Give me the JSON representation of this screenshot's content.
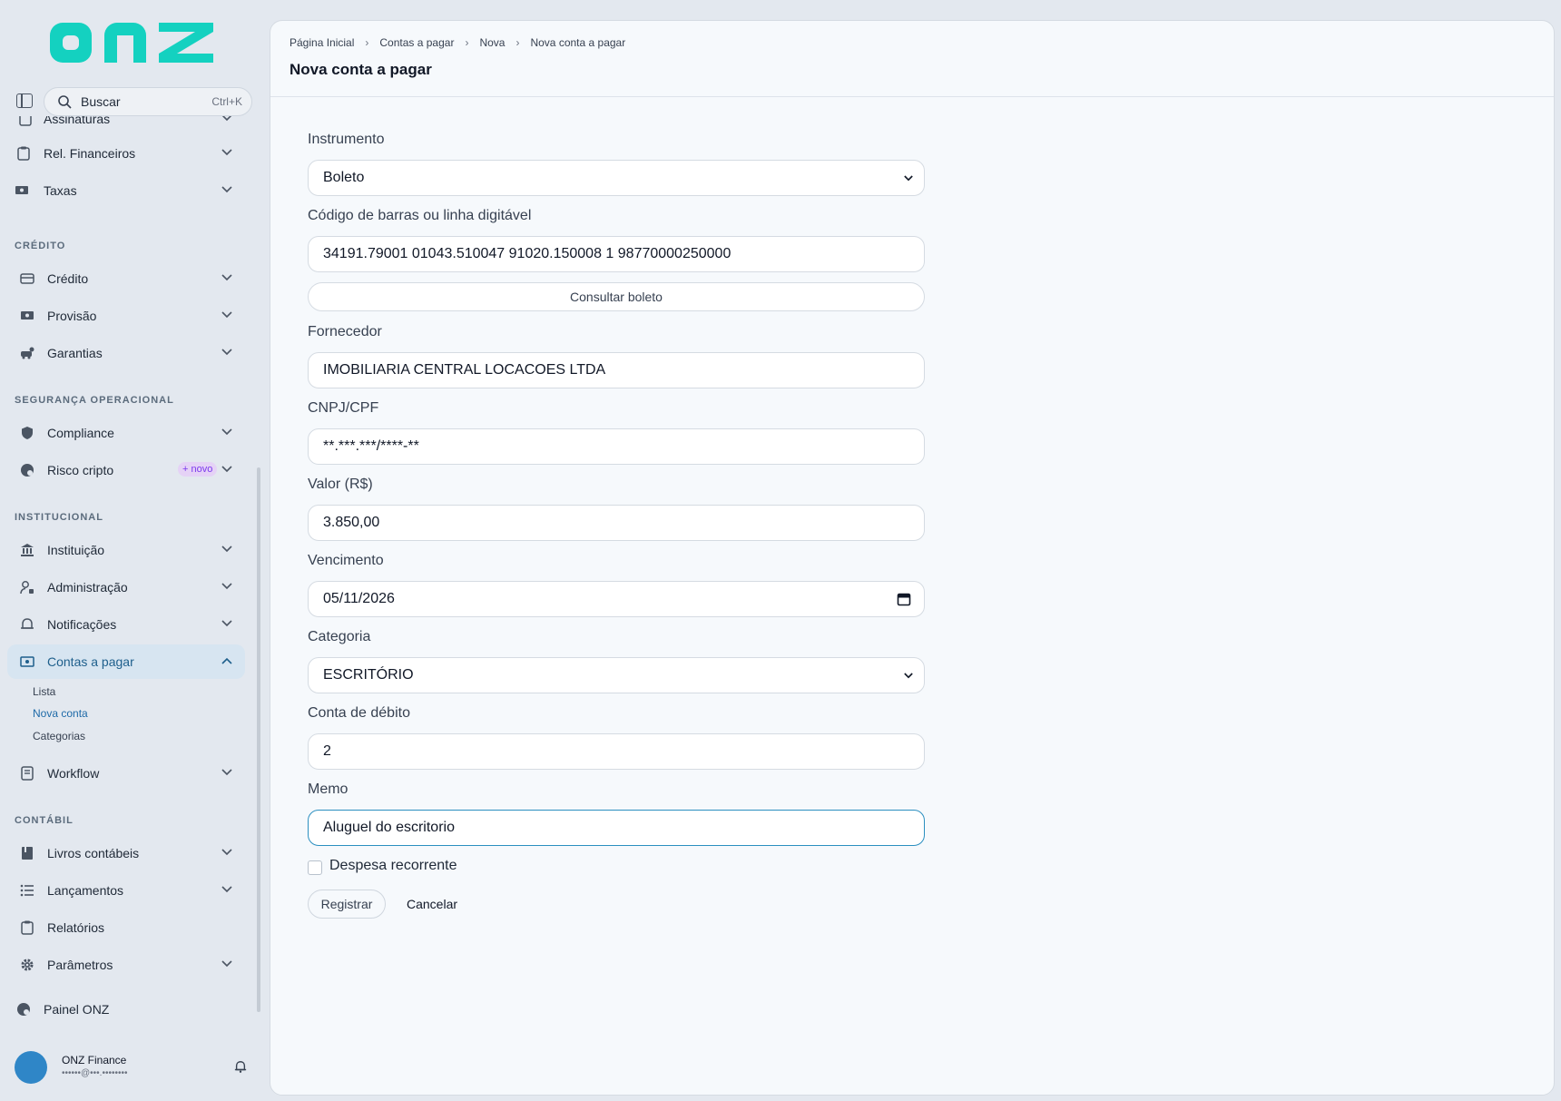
{
  "brand": {
    "logo_text": "onz",
    "logo_color": "#14d1c0"
  },
  "sidebar": {
    "search_placeholder": "Buscar",
    "search_shortcut": "Ctrl+K",
    "items": [
      {
        "label": "Assinaturas",
        "icon": "receipt-icon"
      },
      {
        "label": "Rel. Financeiros",
        "icon": "clipboard-icon"
      },
      {
        "label": "Taxas",
        "icon": "cash-icon"
      },
      {
        "label": "Crédito",
        "icon": "card-icon"
      },
      {
        "label": "Provisão",
        "icon": "cash-icon"
      },
      {
        "label": "Garantias",
        "icon": "car-icon"
      },
      {
        "label": "Compliance",
        "icon": "shield-icon"
      },
      {
        "label": "Risco cripto",
        "icon": "globe-icon",
        "badge": "+ novo"
      },
      {
        "label": "Instituição",
        "icon": "bank-icon"
      },
      {
        "label": "Administração",
        "icon": "user-lock-icon"
      },
      {
        "label": "Notificações",
        "icon": "bell-icon"
      },
      {
        "label": "Contas a pagar",
        "icon": "money-icon",
        "active": true
      },
      {
        "label": "Workflow",
        "icon": "doc-icon"
      },
      {
        "label": "Livros contábeis",
        "icon": "book-icon"
      },
      {
        "label": "Lançamentos",
        "icon": "list-icon"
      },
      {
        "label": "Relatórios",
        "icon": "clipboard-icon"
      },
      {
        "label": "Parâmetros",
        "icon": "gear-icon"
      },
      {
        "label": "Painel ONZ",
        "icon": "globe-icon"
      }
    ],
    "sections": [
      "CRÉDITO",
      "SEGURANÇA OPERACIONAL",
      "INSTITUCIONAL",
      "CONTÁBIL"
    ],
    "subitems": [
      "Lista",
      "Nova conta",
      "Categorias"
    ],
    "user": {
      "name": "ONZ Finance",
      "email": "••••••@•••.••••••••"
    }
  },
  "header": {
    "breadcrumbs": [
      "Página Inicial",
      "Contas a pagar",
      "Nova",
      "Nova conta a pagar"
    ],
    "title": "Nova conta a pagar"
  },
  "form": {
    "instrumento": {
      "label": "Instrumento",
      "value": "Boleto"
    },
    "codigo": {
      "label": "Código de barras ou linha digitável",
      "value": "34191.79001 01043.510047 91020.150008 1 98770000250000"
    },
    "consultar_label": "Consultar boleto",
    "fornecedor": {
      "label": "Fornecedor",
      "value": "IMOBILIARIA CENTRAL LOCACOES LTDA"
    },
    "cnpj": {
      "label": "CNPJ/CPF",
      "value": "**.***.***/****-**"
    },
    "valor": {
      "label": "Valor (R$)",
      "value": "3.850,00"
    },
    "vencimento": {
      "label": "Vencimento",
      "value": "05/11/2026"
    },
    "categoria": {
      "label": "Categoria",
      "value": "ESCRITÓRIO"
    },
    "conta": {
      "label": "Conta de débito",
      "value": "2"
    },
    "memo": {
      "label": "Memo",
      "value": "Aluguel do escritorio"
    },
    "recorrente_label": "Despesa recorrente",
    "registrar_label": "Registrar",
    "cancelar_label": "Cancelar"
  },
  "colors": {
    "accent": "#1e6aa8",
    "active_bg": "#d7e5f1",
    "badge": "#7c3aed"
  }
}
